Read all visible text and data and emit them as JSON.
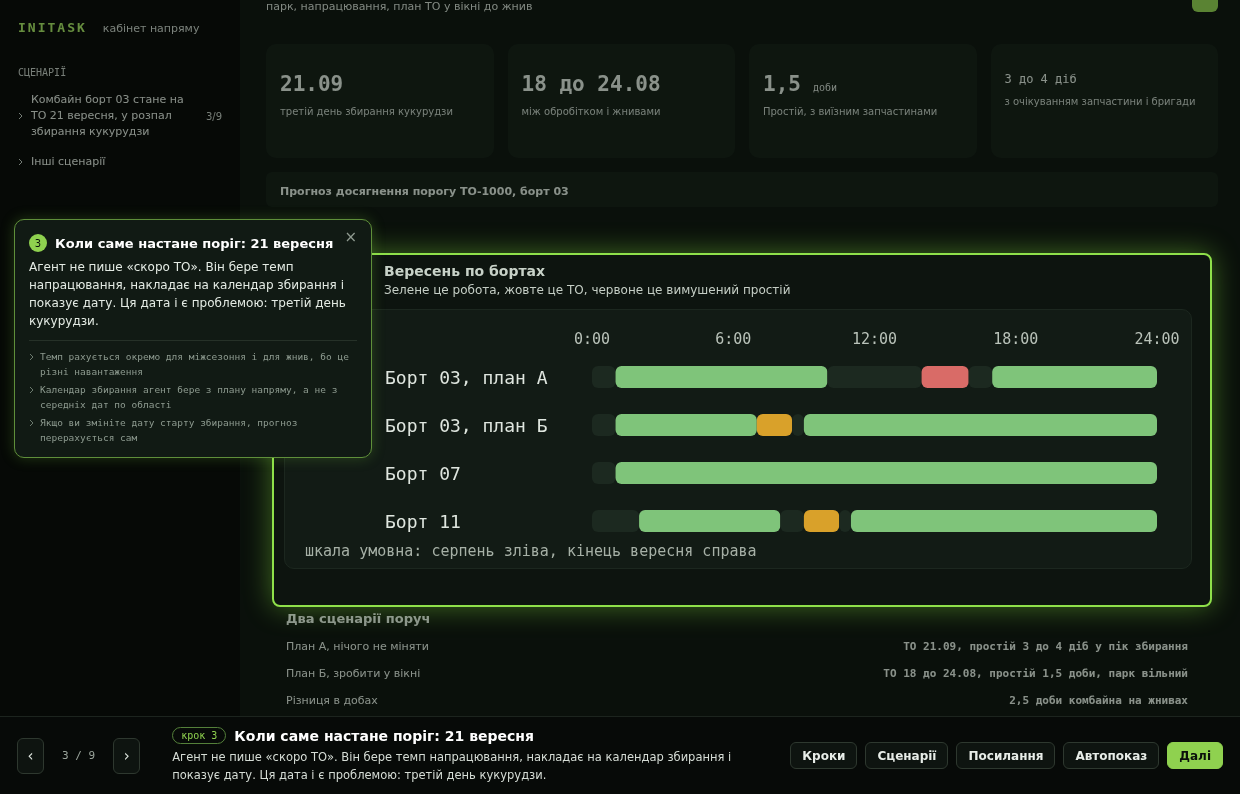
{
  "sidebar": {
    "logo": "INITASK",
    "subtitle": "кабінет напряму",
    "section": "СЦЕНАРІЇ",
    "items": [
      {
        "label": "Комбайн борт 03 стане на ТО 21 вересня, у розпал збирання кукурудзи",
        "count": "3/9"
      },
      {
        "label": "Інші сценарії"
      }
    ]
  },
  "header": {
    "subtitle": "парк, напрацювання, план ТО у вікні до жнив"
  },
  "stats": [
    {
      "kind": "big",
      "value": "21.09",
      "sub": "третій день збирання кукурудзи"
    },
    {
      "kind": "big",
      "value": "18 до 24.08",
      "sub": "між обробітком і жнивами"
    },
    {
      "kind": "big",
      "value": "1,5",
      "unit": "доби",
      "sub": "Простій, з виїзним запчастинами"
    },
    {
      "kind": "small",
      "value": "3 до 4 діб",
      "sub": "з очікуванням запчастини і бригади"
    }
  ],
  "forecast": {
    "title": "Прогноз досягнення порогу ТО-1000, борт 03"
  },
  "chart_card": {
    "title": "Вересень по бортах",
    "subtitle": "Зелене це робота, жовте це ТО, червоне це вимушений простій",
    "note": "шкала умовна: серпень зліва, кінець вересня справа",
    "chart_data": {
      "type": "bar",
      "orientation": "horizontal",
      "stacked": true,
      "categories": [
        "Борт 03, план А",
        "Борт 03, план Б",
        "Борт 07",
        "Борт 11"
      ],
      "xlim": [
        0,
        24
      ],
      "xticks": [
        {
          "value": 0,
          "label": "0:00"
        },
        {
          "value": 6,
          "label": "6:00"
        },
        {
          "value": 12,
          "label": "12:00"
        },
        {
          "value": 18,
          "label": "18:00"
        },
        {
          "value": 24,
          "label": "24:00"
        }
      ],
      "series": [
        {
          "color": "#1c2920",
          "values": [
            1,
            1,
            1,
            2
          ]
        },
        {
          "color": "#7fc47a",
          "values": [
            9,
            6,
            23,
            6
          ]
        },
        {
          "color": "#1c2920",
          "values": [
            4,
            0,
            0,
            1
          ]
        },
        {
          "color": "#d9a12a",
          "values": [
            0,
            1.5,
            0,
            1.5
          ]
        },
        {
          "color": "#d96b67",
          "values": [
            2,
            0,
            0,
            0
          ]
        },
        {
          "color": "#1c2920",
          "values": [
            1,
            0.5,
            0,
            0.5
          ]
        },
        {
          "color": "#7fc47a",
          "values": [
            7,
            15,
            0,
            13
          ]
        }
      ]
    }
  },
  "scenarios": {
    "title": "Два сценарії поруч",
    "rows": [
      {
        "label": "План А, нічого не міняти",
        "value": "ТО 21.09, простій 3 до 4 діб у пік збирання"
      },
      {
        "label": "План Б, зробити у вікні",
        "value": "ТО 18 до 24.08, простій 1,5 доби, парк вільний"
      },
      {
        "label": "Різниця в добах",
        "value": "2,5 доби комбайна на жнивах"
      }
    ]
  },
  "popover": {
    "step": "3",
    "title": "Коли саме настане поріг: 21 вересня",
    "close": "×",
    "body": "Агент не пише «скоро ТО». Він бере темп напрацювання, накладає на календар збирання і показує дату. Ця дата і є проблемою: третій день кукурудзи.",
    "bullets": [
      "Темп рахується окремо для міжсезоння і для жнив, бо це різні навантаження",
      "Календар збирання агент бере з плану напряму, а не з середніх дат по області",
      "Якщо ви змініте дату старту збирання, прогноз перерахується сам"
    ]
  },
  "tour_bar": {
    "prev": "‹",
    "next": "›",
    "counter": "3 / 9",
    "badge": "крок 3",
    "title": "Коли саме настане поріг: 21 вересня",
    "body": "Агент не пише «скоро ТО». Він бере темп напрацювання, накладає на календар збирання і показує дату. Ця дата і є проблемою: третій день кукурудзи.",
    "buttons": [
      {
        "label": "Кроки",
        "primary": false
      },
      {
        "label": "Сценарії",
        "primary": false
      },
      {
        "label": "Посилання",
        "primary": false
      },
      {
        "label": "Автопоказ",
        "primary": false
      },
      {
        "label": "Далі",
        "primary": true
      }
    ]
  }
}
